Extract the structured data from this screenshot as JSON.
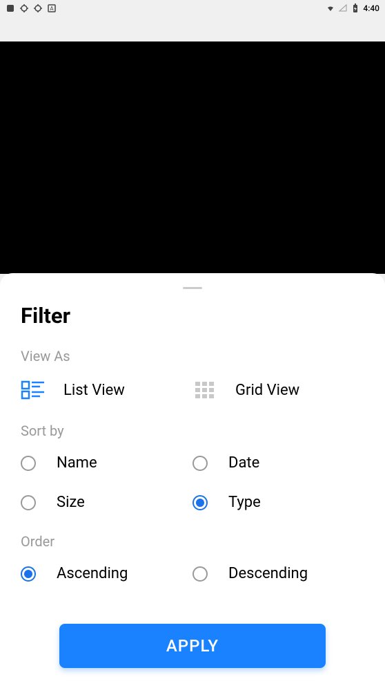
{
  "statusBar": {
    "time": "4:40"
  },
  "sheet": {
    "title": "Filter",
    "sections": {
      "viewAs": {
        "label": "View As",
        "options": {
          "list": "List View",
          "grid": "Grid View"
        }
      },
      "sortBy": {
        "label": "Sort by",
        "options": {
          "name": "Name",
          "date": "Date",
          "size": "Size",
          "type": "Type"
        }
      },
      "order": {
        "label": "Order",
        "options": {
          "ascending": "Ascending",
          "descending": "Descending"
        }
      }
    },
    "applyButton": "APPLY"
  },
  "state": {
    "viewAs": "list",
    "sortBy": "type",
    "order": "ascending"
  }
}
